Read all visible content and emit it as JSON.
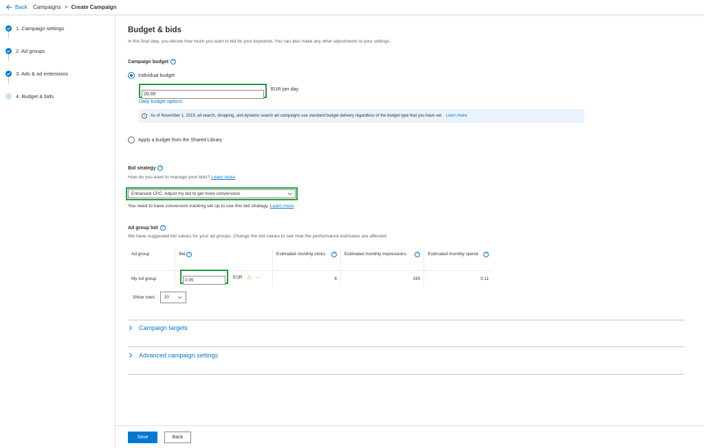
{
  "header": {
    "back_label": "Back",
    "breadcrumb_parent": "Campaigns",
    "breadcrumb_sep": ">",
    "breadcrumb_current": "Create Campaign"
  },
  "steps": [
    {
      "label": "1. Campaign settings",
      "state": "done"
    },
    {
      "label": "2. Ad groups",
      "state": "done"
    },
    {
      "label": "3. Ads & ad extensions",
      "state": "done"
    },
    {
      "label": "4. Budget & bids",
      "state": "current"
    }
  ],
  "page": {
    "title": "Budget & bids",
    "description": "In this final step, you decide how much you want to bid for your keywords. You can also make any other adjustments to your settings."
  },
  "budget": {
    "section_title": "Campaign budget",
    "option_individual": "Individual budget",
    "value": "20.00",
    "currency": "EUR",
    "period": "per day",
    "daily_options_link": "Daily budget options",
    "info_text": "As of November 1, 2019, all search, shopping, and dynamic search ad campaigns use standard budget delivery regardless of the budget type that you have set.",
    "info_link": "Learn more",
    "option_shared": "Apply a budget from the Shared Library"
  },
  "bid_strategy": {
    "section_title": "Bid strategy",
    "question": "How do you want to manage your bids?",
    "question_link": "Learn more",
    "selected": "Enhanced CPC: Adjust my bid to get more conversions",
    "note": "You need to have conversion tracking set up to use this bid strategy.",
    "note_link": "Learn more"
  },
  "ad_group_bid": {
    "section_title": "Ad group bid",
    "description": "We have suggested bid values for your ad groups. Change the bid values to see how the performance estimates are affected.",
    "columns": [
      "Ad group",
      "Bid",
      "Estimated monthly clicks",
      "Estimated monthly impressions",
      "Estimated monthly spend"
    ],
    "rows": [
      {
        "ad_group": "My Ad group",
        "bid": "0.05",
        "currency": "EUR",
        "clicks": "8",
        "impressions": "195",
        "spend": "0.11"
      }
    ],
    "show_rows_label": "Show rows:",
    "show_rows_value": "20"
  },
  "expanders": {
    "campaign_targets": "Campaign targets",
    "advanced_settings": "Advanced campaign settings"
  },
  "footer": {
    "save_label": "Save",
    "back_label": "Back"
  },
  "colors": {
    "accent": "#0078d4",
    "highlight": "#1e9c36",
    "warning": "#e8a800"
  }
}
